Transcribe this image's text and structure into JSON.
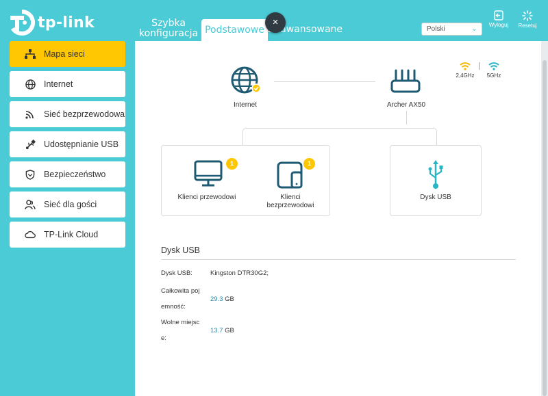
{
  "header": {
    "logo_text": "tp-link",
    "tabs": [
      {
        "label_line1": "Szybka",
        "label_line2": "konfiguracja"
      },
      {
        "label": "Podstawowe"
      },
      {
        "label": "Zaawansowane"
      }
    ],
    "close_symbol": "×",
    "language": {
      "selected": "Polski"
    },
    "logout_label": "Wyloguj",
    "reset_label": "Resetuj"
  },
  "sidebar": {
    "items": [
      {
        "label": "Mapa sieci",
        "icon": "network-map-icon",
        "active": true
      },
      {
        "label": "Internet",
        "icon": "globe-icon"
      },
      {
        "label": "Sieć bezprzewodowa",
        "icon": "wireless-icon"
      },
      {
        "label": "Udostępnianie USB",
        "icon": "usb-icon"
      },
      {
        "label": "Bezpieczeństwo",
        "icon": "shield-icon"
      },
      {
        "label": "Sieć dla gości",
        "icon": "guests-icon"
      },
      {
        "label": "TP-Link Cloud",
        "icon": "cloud-icon"
      }
    ]
  },
  "map": {
    "internet_label": "Internet",
    "router_label": "Archer AX50",
    "wifi_24_label": "2,4GHz",
    "wifi_5_label": "5GHz",
    "wired_label": "Klienci przewodowi",
    "wired_count": "1",
    "wireless_label_line1": "Klienci",
    "wireless_label_line2": "bezprzewodowi",
    "wireless_count": "1",
    "usb_label": "Dysk USB"
  },
  "usb_section": {
    "title": "Dysk USB",
    "disk_label": "Dysk USB:",
    "disk_value": "Kingston DTR30G2;",
    "total_label_line1": "Całkowita poj",
    "total_label_line2": "emność:",
    "total_value": "29.3",
    "total_unit": "GB",
    "free_label_line1": "Wolne miejsc",
    "free_label_line2": "e:",
    "free_value": "13.7",
    "free_unit": "GB"
  },
  "colors": {
    "brand": "#4acbd6",
    "active": "#ffc702",
    "icon": "#1f5a73",
    "wifi_24": "#f5b800",
    "wifi_5": "#2ab5c6"
  }
}
